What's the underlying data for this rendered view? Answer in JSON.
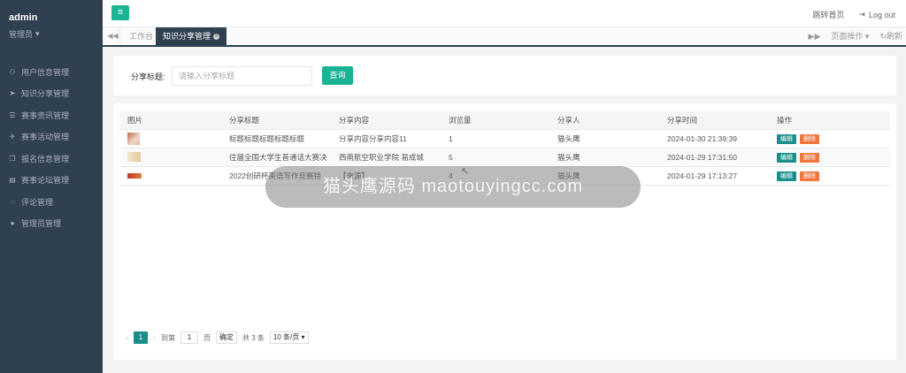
{
  "sidebar": {
    "user": "admin",
    "role": "管理员",
    "items": [
      {
        "icon": "user-icon",
        "glyph": "⚇",
        "label": "用户信息管理"
      },
      {
        "icon": "send-icon",
        "glyph": "➤",
        "label": "知识分享管理"
      },
      {
        "icon": "list-icon",
        "glyph": "☰",
        "label": "赛事资讯管理"
      },
      {
        "icon": "rocket-icon",
        "glyph": "✈",
        "label": "赛事活动管理"
      },
      {
        "icon": "copy-icon",
        "glyph": "❐",
        "label": "报名信息管理"
      },
      {
        "icon": "book-icon",
        "glyph": "▤",
        "label": "赛事论坛管理"
      },
      {
        "icon": "comment-icon",
        "glyph": "◌",
        "label": "评论管理"
      },
      {
        "icon": "person-icon",
        "glyph": "●",
        "label": "管理员管理"
      }
    ]
  },
  "topbar": {
    "home_label": "跳转首页",
    "logout_label": "Log out"
  },
  "tabs": {
    "home": "工作台",
    "active": "知识分享管理",
    "page_ops": "页面操作",
    "refresh": "刷新"
  },
  "search": {
    "label": "分享标题:",
    "placeholder": "请输入分享标题",
    "button": "查询"
  },
  "table": {
    "headers": [
      "图片",
      "分享标题",
      "分享内容",
      "浏览量",
      "分享人",
      "分享时间",
      "操作"
    ],
    "rows": [
      {
        "thumb": "a",
        "title": "标题标题标题标题标题",
        "content": "分享内容分享内容11",
        "views": "1",
        "sharer": "猫头鹰",
        "time": "2024-01-30 21:39:39"
      },
      {
        "thumb": "b",
        "title": "往届全国大学生普通话大赛决",
        "content": "西南航空职业学院 易成城",
        "views": "5",
        "sharer": "猫头鹰",
        "time": "2024-01-29 17:31:50"
      },
      {
        "thumb": "c",
        "title": "2022创研杯英语写作竞赛特",
        "content": "【来源】",
        "views": "4",
        "sharer": "猫头鹰",
        "time": "2024-01-29 17:13:27"
      }
    ],
    "edit_label": "编辑",
    "delete_label": "删除"
  },
  "pager": {
    "current": "1",
    "goto_label": "到第",
    "page_value": "1",
    "page_unit": "页",
    "confirm": "确定",
    "total": "共 3 条",
    "page_size": "10 条/页"
  },
  "watermark": {
    "text": "猫头鹰源码 maotouyingcc.com"
  },
  "colors": {
    "sidebar": "#2f4050",
    "primary": "#1ab394",
    "edit": "#1a8f8a",
    "delete": "#f0763d"
  }
}
